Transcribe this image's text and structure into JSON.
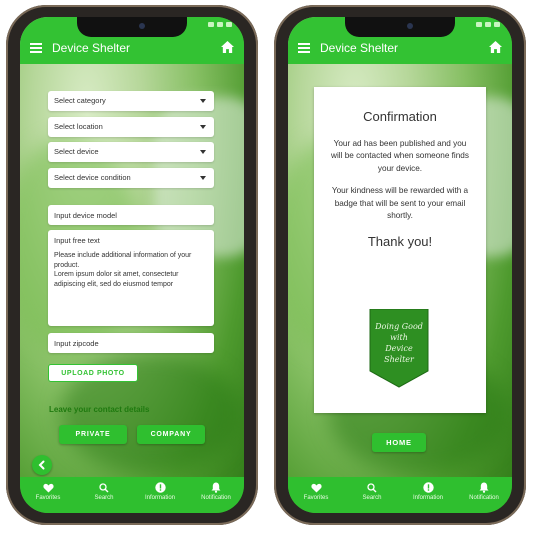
{
  "app": {
    "title": "Device Shelter"
  },
  "left_screen": {
    "selects": [
      {
        "label": "Select category"
      },
      {
        "label": "Select location"
      },
      {
        "label": "Select device"
      },
      {
        "label": "Select device condition"
      }
    ],
    "device_model_placeholder": "Input device model",
    "free_text": {
      "label": "Input free text",
      "body": "Please include additional information of your product.\nLorem ipsum dolor sit amet, consectetur adipiscing elit, sed do eiusmod tempor"
    },
    "zipcode_placeholder": "Input zipcode",
    "upload_photo_label": "UPLOAD PHOTO",
    "contact_label": "Leave your contact details",
    "private_label": "PRIVATE",
    "company_label": "COMPANY"
  },
  "right_screen": {
    "dialog": {
      "title": "Confirmation",
      "message1": "Your ad has been published and you will be contacted when someone finds your device.",
      "message2": "Your kindness will be rewarded with a badge that will be sent to your email shortly.",
      "thanks": "Thank you!"
    },
    "badge_text": [
      "Doing Good",
      "with",
      "Device",
      "Shelter"
    ],
    "home_button_label": "HOME"
  },
  "bottom_nav": [
    {
      "label": "Favorites",
      "icon": "heart-icon"
    },
    {
      "label": "Search",
      "icon": "search-icon"
    },
    {
      "label": "Information",
      "icon": "info-icon"
    },
    {
      "label": "Notification",
      "icon": "bell-icon"
    }
  ],
  "colors": {
    "primary_green": "#33c233",
    "dark_green_text": "#1f7a0f"
  }
}
